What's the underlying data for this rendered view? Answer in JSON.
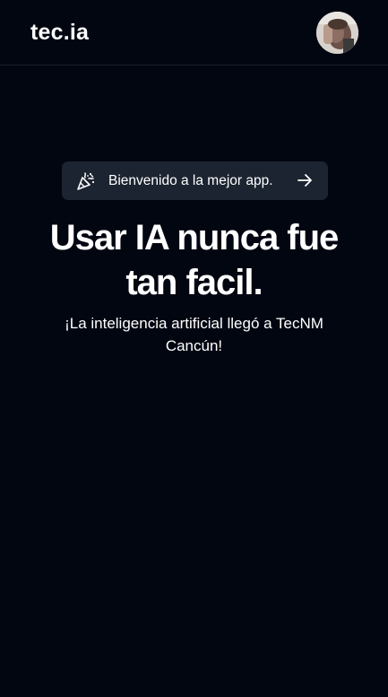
{
  "header": {
    "logo": "tec.ia",
    "avatar_icon": "user-avatar-photo"
  },
  "announcement": {
    "icon": "party-popper-icon",
    "text": "Bienvenido a la mejor app.",
    "arrow_icon": "arrow-right-icon"
  },
  "hero": {
    "headline_line1": "Usar IA nunca fue",
    "headline_line2": "tan facil.",
    "subtitle_line1": "¡La inteligencia artificial llegó a TecNM",
    "subtitle_line2": "Cancún!"
  },
  "colors": {
    "background": "#020611",
    "pill": "#1c2431",
    "text": "#ffffff"
  }
}
